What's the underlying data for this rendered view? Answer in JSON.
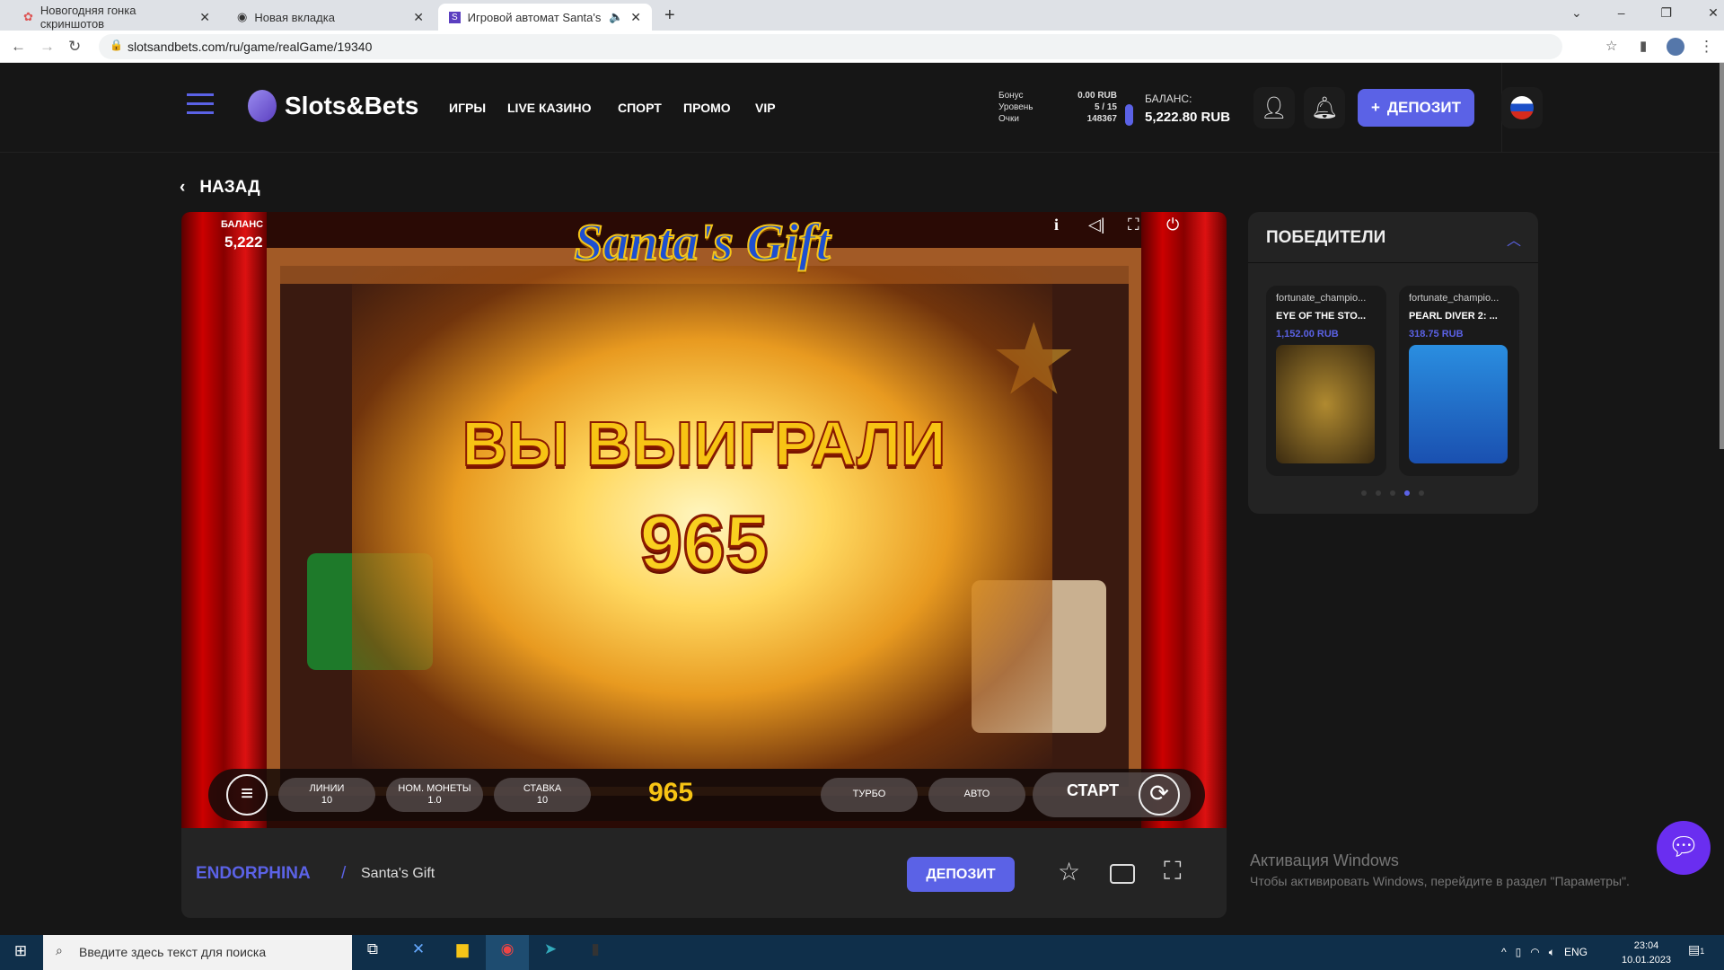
{
  "browser": {
    "tabs": [
      {
        "title": "Новогодняя гонка скриншотов"
      },
      {
        "title": "Новая вкладка"
      },
      {
        "title": "Игровой автомат Santa's Gi"
      }
    ],
    "url": "slotsandbets.com/ru/game/realGame/19340"
  },
  "header": {
    "logo": "Slots&Bets",
    "nav": [
      "ИГРЫ",
      "LIVE КАЗИНО",
      "СПОРТ",
      "ПРОМО",
      "VIP"
    ],
    "stats": {
      "bonus_label": "Бонус",
      "bonus": "0.00 RUB",
      "level_label": "Уровень",
      "level": "5 / 15",
      "points_label": "Очки",
      "points": "148367"
    },
    "balance_label": "БАЛАНС:",
    "balance": "5,222.80 RUB",
    "deposit": "ДЕПОЗИТ"
  },
  "back": "НАЗАД",
  "game": {
    "balance_label": "БАЛАНС",
    "balance": "5,222",
    "logo": "Santa's Gift",
    "win_title": "ВЫ ВЫИГРАЛИ",
    "win_amount": "965",
    "controls": {
      "lines_label": "ЛИНИИ",
      "lines": "10",
      "coin_label": "НОМ. МОНЕТЫ",
      "coin": "1.0",
      "bet_label": "СТАВКА",
      "bet": "10",
      "win": "965",
      "turbo": "ТУРБО",
      "auto": "АВТО",
      "start": "СТАРТ"
    }
  },
  "bottom": {
    "provider": "ENDORPHINA",
    "separator": "/",
    "game": "Santa's Gift",
    "deposit": "ДЕПОЗИТ"
  },
  "winners": {
    "title": "ПОБЕДИТЕЛИ",
    "items": [
      {
        "user": "fortunate_champio...",
        "game": "EYE OF THE STO...",
        "amount": "1,152.00 RUB"
      },
      {
        "user": "fortunate_champio...",
        "game": "PEARL DIVER 2: ...",
        "amount": "318.75 RUB"
      }
    ],
    "active_page": 4,
    "pages": 5
  },
  "windows": {
    "title": "Активация Windows",
    "subtitle": "Чтобы активировать Windows, перейдите в раздел \"Параметры\".",
    "search_placeholder": "Введите здесь текст для поиска",
    "lang": "ENG",
    "time": "23:04",
    "date": "10.01.2023",
    "notif": "1"
  },
  "colors": {
    "accent": "#5b62e6",
    "bg": "#161616"
  }
}
